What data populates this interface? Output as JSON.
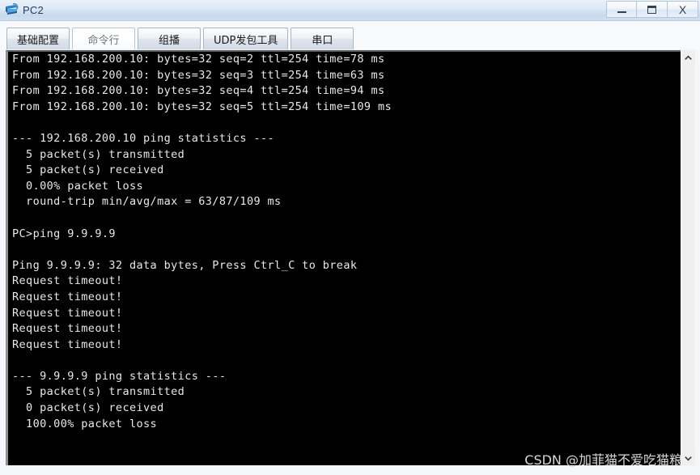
{
  "window": {
    "title": "PC2",
    "icon": "pc-device-icon",
    "controls": [
      {
        "name": "minimize-button",
        "glyph": "—"
      },
      {
        "name": "maximize-button",
        "glyph": "▢"
      },
      {
        "name": "close-button",
        "glyph": "X"
      }
    ]
  },
  "tabs": [
    {
      "label": "基础配置",
      "selected": false
    },
    {
      "label": "命令行",
      "selected": true
    },
    {
      "label": "组播",
      "selected": false
    },
    {
      "label": "UDP发包工具",
      "selected": false
    },
    {
      "label": "串口",
      "selected": false
    }
  ],
  "terminal": {
    "prompt": "PC>",
    "cursor_visible": true,
    "lines": [
      "From 192.168.200.10: bytes=32 seq=2 ttl=254 time=78 ms",
      "From 192.168.200.10: bytes=32 seq=3 ttl=254 time=63 ms",
      "From 192.168.200.10: bytes=32 seq=4 ttl=254 time=94 ms",
      "From 192.168.200.10: bytes=32 seq=5 ttl=254 time=109 ms",
      "",
      "--- 192.168.200.10 ping statistics ---",
      "  5 packet(s) transmitted",
      "  5 packet(s) received",
      "  0.00% packet loss",
      "  round-trip min/avg/max = 63/87/109 ms",
      "",
      "PC>ping 9.9.9.9",
      "",
      "Ping 9.9.9.9: 32 data bytes, Press Ctrl_C to break",
      "Request timeout!",
      "Request timeout!",
      "Request timeout!",
      "Request timeout!",
      "Request timeout!",
      "",
      "--- 9.9.9.9 ping statistics ---",
      "  5 packet(s) transmitted",
      "  0 packet(s) received",
      "  100.00% packet loss",
      "",
      ""
    ]
  },
  "scrollbar": {
    "up_arrow": "chevron-up-icon",
    "down_arrow": "chevron-down-icon"
  },
  "watermark": {
    "text": "CSDN @加菲猫不爱吃猫粮"
  },
  "colors": {
    "terminal_background": "#000000",
    "terminal_text": "#e8e8e8",
    "title_accent": "#1f3a5f",
    "tab_selected_text": "#6f7780"
  }
}
